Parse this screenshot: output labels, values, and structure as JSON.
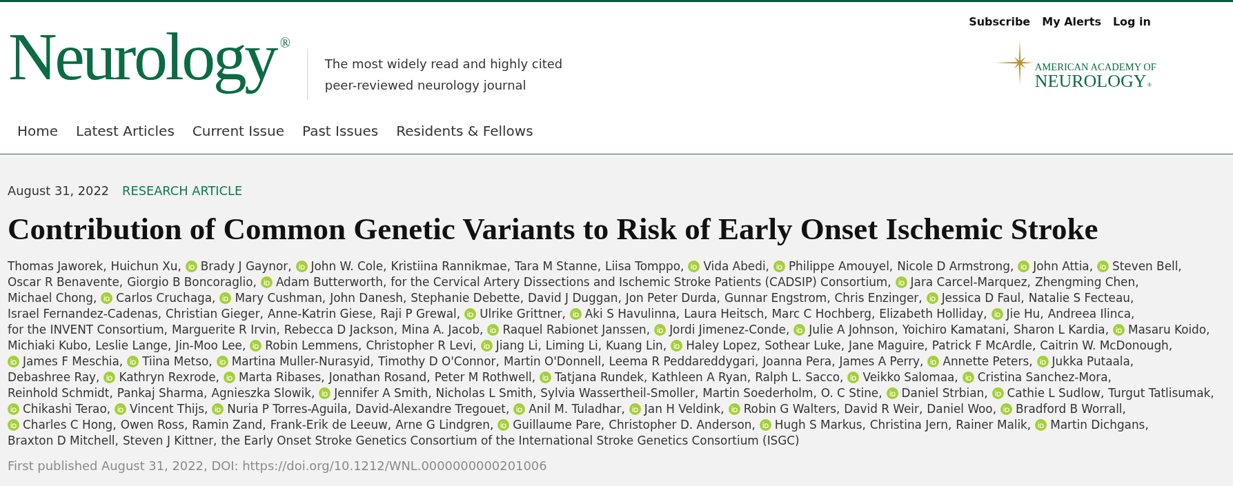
{
  "header": {
    "logo": "Neurology$^{®}$",
    "tagline": "The most widely read and highly cited peer-reviewed neurology journal",
    "top_links": [
      "Subscribe",
      "My Alerts",
      "Log in"
    ],
    "society_logo": {
      "line_1": "AMERICAN ACADEMY OF",
      "line_2": "NEUROLOGY$_{®}$"
    }
  },
  "nav": [
    "Home",
    "Latest Articles",
    "Current Issue",
    "Past Issues",
    "Residents & Fellows"
  ],
  "article": {
    "date": "August 31, 2022",
    "type": "RESEARCH ARTICLE",
    "title": "Contribution of Common Genetic Variants to Risk of Early Onset Ischemic Stroke",
    "authors": [
      {
        "name": "Thomas Jaworek,",
        "orcid": false
      },
      {
        "name": "Huichun Xu,",
        "orcid": false
      },
      {
        "name": "Brady J Gaynor,",
        "orcid": true
      },
      {
        "name": "John W. Cole,",
        "orcid": true
      },
      {
        "name": "Kristiina Rannikmae,",
        "orcid": false
      },
      {
        "name": "Tara M Stanne,",
        "orcid": false
      },
      {
        "name": "Liisa Tomppo,",
        "orcid": false
      },
      {
        "name": "Vida Abedi,",
        "orcid": true
      },
      {
        "name": "Philippe Amouyel,",
        "orcid": true
      },
      {
        "name": "Nicole D Armstrong,",
        "orcid": false
      },
      {
        "name": "John Attia,",
        "orcid": true
      },
      {
        "name": "Steven Bell,",
        "orcid": true
      },
      {
        "name": "Oscar R Benavente,",
        "orcid": false
      },
      {
        "name": "Giorgio B Boncoraglio,",
        "orcid": false
      },
      {
        "name": "Adam Butterworth,",
        "orcid": true
      },
      {
        "name": "for the Cervical Artery Dissections and Ischemic Stroke Patients (CADSIP) Consortium,",
        "orcid": false
      },
      {
        "name": "Jara Carcel-Marquez,",
        "orcid": true
      },
      {
        "name": "Zhengming Chen,",
        "orcid": false
      },
      {
        "name": "Michael Chong,",
        "orcid": false
      },
      {
        "name": "Carlos Cruchaga,",
        "orcid": true
      },
      {
        "name": "Mary Cushman,",
        "orcid": true
      },
      {
        "name": "John Danesh,",
        "orcid": false
      },
      {
        "name": "Stephanie Debette,",
        "orcid": false
      },
      {
        "name": "David J Duggan,",
        "orcid": false
      },
      {
        "name": "Jon Peter Durda,",
        "orcid": false
      },
      {
        "name": "Gunnar Engstrom,",
        "orcid": false
      },
      {
        "name": "Chris Enzinger,",
        "orcid": false
      },
      {
        "name": "Jessica D Faul,",
        "orcid": true
      },
      {
        "name": "Natalie S Fecteau,",
        "orcid": false
      },
      {
        "name": "Israel Fernandez-Cadenas,",
        "orcid": false
      },
      {
        "name": "Christian Gieger,",
        "orcid": false
      },
      {
        "name": "Anne-Katrin Giese,",
        "orcid": false
      },
      {
        "name": "Raji P Grewal,",
        "orcid": false
      },
      {
        "name": "Ulrike Grittner,",
        "orcid": true
      },
      {
        "name": "Aki S Havulinna,",
        "orcid": true
      },
      {
        "name": "Laura Heitsch,",
        "orcid": false
      },
      {
        "name": "Marc C Hochberg,",
        "orcid": false
      },
      {
        "name": "Elizabeth Holliday,",
        "orcid": false
      },
      {
        "name": "Jie Hu,",
        "orcid": true
      },
      {
        "name": "Andreea Ilinca,",
        "orcid": false
      },
      {
        "name": "for the INVENT Consortium,",
        "orcid": false
      },
      {
        "name": "Marguerite R Irvin,",
        "orcid": false
      },
      {
        "name": "Rebecca D Jackson,",
        "orcid": false
      },
      {
        "name": "Mina A. Jacob,",
        "orcid": false
      },
      {
        "name": "Raquel Rabionet Janssen,",
        "orcid": true
      },
      {
        "name": "Jordi Jimenez-Conde,",
        "orcid": true
      },
      {
        "name": "Julie A Johnson,",
        "orcid": true
      },
      {
        "name": "Yoichiro Kamatani,",
        "orcid": false
      },
      {
        "name": "Sharon L Kardia,",
        "orcid": false
      },
      {
        "name": "Masaru Koido,",
        "orcid": true
      },
      {
        "name": "Michiaki Kubo,",
        "orcid": false
      },
      {
        "name": "Leslie Lange,",
        "orcid": false
      },
      {
        "name": "Jin-Moo Lee,",
        "orcid": false
      },
      {
        "name": "Robin Lemmens,",
        "orcid": true
      },
      {
        "name": "Christopher R Levi,",
        "orcid": false
      },
      {
        "name": "Jiang Li,",
        "orcid": true
      },
      {
        "name": "Liming Li,",
        "orcid": false
      },
      {
        "name": "Kuang Lin,",
        "orcid": false
      },
      {
        "name": "Haley Lopez,",
        "orcid": true
      },
      {
        "name": "Sothear Luke,",
        "orcid": false
      },
      {
        "name": "Jane Maguire,",
        "orcid": false
      },
      {
        "name": "Patrick F McArdle,",
        "orcid": false
      },
      {
        "name": "Caitrin W. McDonough,",
        "orcid": false
      },
      {
        "name": "James F Meschia,",
        "orcid": true
      },
      {
        "name": "Tiina Metso,",
        "orcid": true
      },
      {
        "name": "Martina Muller-Nurasyid,",
        "orcid": true
      },
      {
        "name": "Timothy D O'Connor,",
        "orcid": false
      },
      {
        "name": "Martin O'Donnell,",
        "orcid": false
      },
      {
        "name": "Leema R Peddareddygari,",
        "orcid": false
      },
      {
        "name": "Joanna Pera,",
        "orcid": false
      },
      {
        "name": "James A Perry,",
        "orcid": false
      },
      {
        "name": "Annette Peters,",
        "orcid": true
      },
      {
        "name": "Jukka Putaala,",
        "orcid": true
      },
      {
        "name": "Debashree Ray,",
        "orcid": false
      },
      {
        "name": "Kathryn Rexrode,",
        "orcid": true
      },
      {
        "name": "Marta Ribases,",
        "orcid": true
      },
      {
        "name": "Jonathan Rosand,",
        "orcid": false
      },
      {
        "name": "Peter M Rothwell,",
        "orcid": false
      },
      {
        "name": "Tatjana Rundek,",
        "orcid": true
      },
      {
        "name": "Kathleen A Ryan,",
        "orcid": false
      },
      {
        "name": "Ralph L. Sacco,",
        "orcid": false
      },
      {
        "name": "Veikko Salomaa,",
        "orcid": true
      },
      {
        "name": "Cristina Sanchez-Mora,",
        "orcid": true
      },
      {
        "name": "Reinhold Schmidt,",
        "orcid": false
      },
      {
        "name": "Pankaj Sharma,",
        "orcid": false
      },
      {
        "name": "Agnieszka Slowik,",
        "orcid": false
      },
      {
        "name": "Jennifer A Smith,",
        "orcid": true
      },
      {
        "name": "Nicholas L Smith,",
        "orcid": false
      },
      {
        "name": "Sylvia Wassertheil-Smoller,",
        "orcid": false
      },
      {
        "name": "Martin Soederholm,",
        "orcid": false
      },
      {
        "name": "O. C Stine,",
        "orcid": false
      },
      {
        "name": "Daniel Strbian,",
        "orcid": true
      },
      {
        "name": "Cathie L Sudlow,",
        "orcid": true
      },
      {
        "name": "Turgut Tatlisumak,",
        "orcid": false
      },
      {
        "name": "Chikashi Terao,",
        "orcid": true
      },
      {
        "name": "Vincent Thijs,",
        "orcid": true
      },
      {
        "name": "Nuria P Torres-Aguila,",
        "orcid": true
      },
      {
        "name": "David-Alexandre Tregouet,",
        "orcid": false
      },
      {
        "name": "Anil M. Tuladhar,",
        "orcid": true
      },
      {
        "name": "Jan H Veldink,",
        "orcid": true
      },
      {
        "name": "Robin G Walters,",
        "orcid": true
      },
      {
        "name": "David R Weir,",
        "orcid": false
      },
      {
        "name": "Daniel Woo,",
        "orcid": false
      },
      {
        "name": "Bradford B Worrall,",
        "orcid": true
      },
      {
        "name": "Charles C Hong,",
        "orcid": true
      },
      {
        "name": "Owen Ross,",
        "orcid": false
      },
      {
        "name": "Ramin Zand,",
        "orcid": false
      },
      {
        "name": "Frank-Erik de Leeuw,",
        "orcid": false
      },
      {
        "name": "Arne G Lindgren,",
        "orcid": false
      },
      {
        "name": "Guillaume Pare,",
        "orcid": true
      },
      {
        "name": "Christopher D. Anderson,",
        "orcid": false
      },
      {
        "name": "Hugh S Markus,",
        "orcid": true
      },
      {
        "name": "Christina Jern,",
        "orcid": false
      },
      {
        "name": "Rainer Malik,",
        "orcid": false
      },
      {
        "name": "Martin Dichgans,",
        "orcid": true
      },
      {
        "name": "Braxton D Mitchell,",
        "orcid": false
      },
      {
        "name": "Steven J Kittner,",
        "orcid": false
      },
      {
        "name": "the Early Onset Stroke Genetics Consortium of the International Stroke Genetics Consortium (ISGC)",
        "orcid": false
      }
    ],
    "publication_line": "First published August 31, 2022, DOI: https://doi.org/10.1212/WNL.0000000000201006"
  }
}
